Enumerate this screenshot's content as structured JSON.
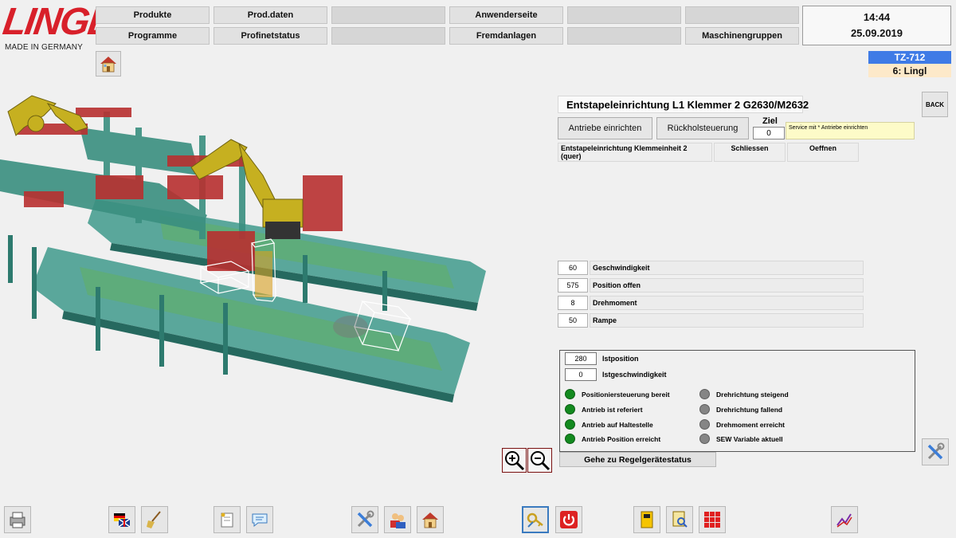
{
  "logo": {
    "text": "LINGL",
    "sub": "MADE IN GERMANY"
  },
  "nav": {
    "row1": [
      "Produkte",
      "Prod.daten",
      "",
      "Anwenderseite",
      "",
      ""
    ],
    "row2": [
      "Programme",
      "Profinetstatus",
      "",
      "Fremdanlagen",
      "",
      "Maschinengruppen"
    ]
  },
  "clock": {
    "time": "14:44",
    "date": "25.09.2019"
  },
  "station": {
    "id": "TZ-712",
    "user": "6: Lingl"
  },
  "panel": {
    "title": "Entstapeleinrichtung L1 Klemmer 2 G2630/M2632",
    "back_label": "BACK",
    "btn_drives": "Antriebe einrichten",
    "btn_return": "Rückholsteuerung",
    "ziel_label": "Ziel",
    "ziel_value": "0",
    "service_note": "Service mit * Antriebe einrichten",
    "table": {
      "name": "Entstapeleinrichtung Klemmeinheit 2 (quer)",
      "col1": "Schliessen",
      "col2": "Oeffnen"
    }
  },
  "params": [
    {
      "value": "60",
      "label": "Geschwindigkeit"
    },
    {
      "value": "575",
      "label": "Position offen"
    },
    {
      "value": "8",
      "label": "Drehmoment"
    },
    {
      "value": "50",
      "label": "Rampe"
    }
  ],
  "status": {
    "istposition_value": "280",
    "istposition_label": "Istposition",
    "istgeschw_value": "0",
    "istgeschw_label": "Istgeschwindigkeit",
    "left": [
      {
        "label": "Positioniersteuerung bereit",
        "state": "green"
      },
      {
        "label": "Antrieb ist referiert",
        "state": "green"
      },
      {
        "label": "Antrieb auf Haltestelle",
        "state": "green"
      },
      {
        "label": "Antrieb Position erreicht",
        "state": "green"
      }
    ],
    "right": [
      {
        "label": "Drehrichtung steigend",
        "state": "gray"
      },
      {
        "label": "Drehrichtung fallend",
        "state": "gray"
      },
      {
        "label": "Drehmoment erreicht",
        "state": "gray"
      },
      {
        "label": "SEW Variable aktuell",
        "state": "gray"
      }
    ]
  },
  "goto_label": "Gehe zu Regelgerätestatus",
  "colors": {
    "brand_red": "#d8202a",
    "station_blue": "#3f7be6",
    "led_green": "#138a1f",
    "led_gray": "#858585",
    "machine_teal": "#2f8a7a",
    "machine_red": "#b83030",
    "robot_yellow": "#c6b020"
  },
  "icons": {
    "home": "home-icon",
    "toolbar": [
      "printer-icon",
      "language-flag-icon",
      "broom-icon",
      "note-icon",
      "speech-bubble-icon",
      "tools-icon",
      "users-icon",
      "home-icon",
      "key-icon",
      "power-icon",
      "binder-icon",
      "document-search-icon",
      "grid-icon",
      "trend-chart-icon"
    ]
  }
}
